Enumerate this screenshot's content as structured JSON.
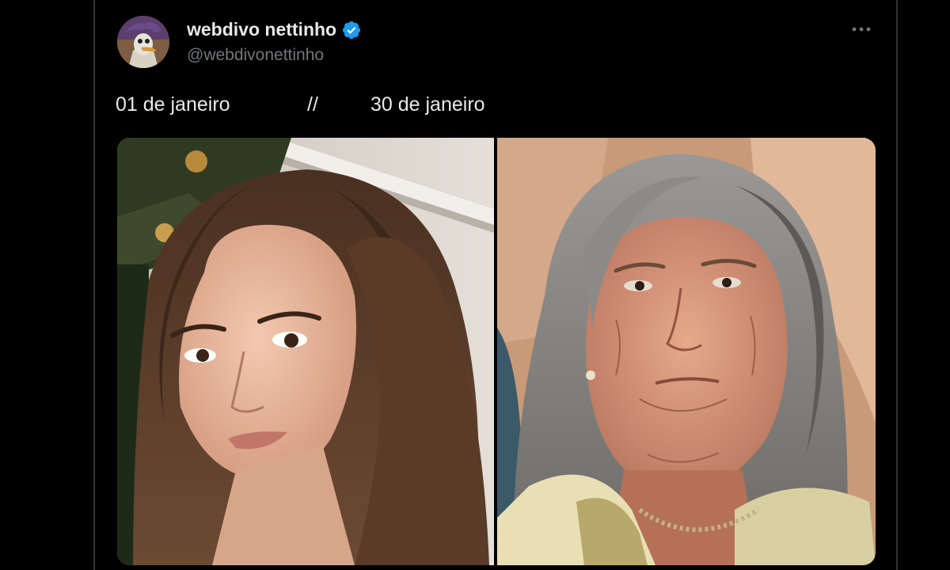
{
  "tweet": {
    "author": {
      "display_name": "webdivo nettinho",
      "handle": "@webdivonettinho",
      "verified": true
    },
    "more_icon": "more-horizontal-icon",
    "text": {
      "left": "01 de janeiro",
      "separator": "//",
      "right": "30 de janeiro"
    },
    "media": [
      {
        "name": "photo-young-woman"
      },
      {
        "name": "photo-elderly-woman"
      }
    ]
  },
  "colors": {
    "background": "#000000",
    "primary_text": "#e7e9ea",
    "secondary_text": "#71767b",
    "verified_blue": "#1d9bf0",
    "border": "#2f3336"
  }
}
